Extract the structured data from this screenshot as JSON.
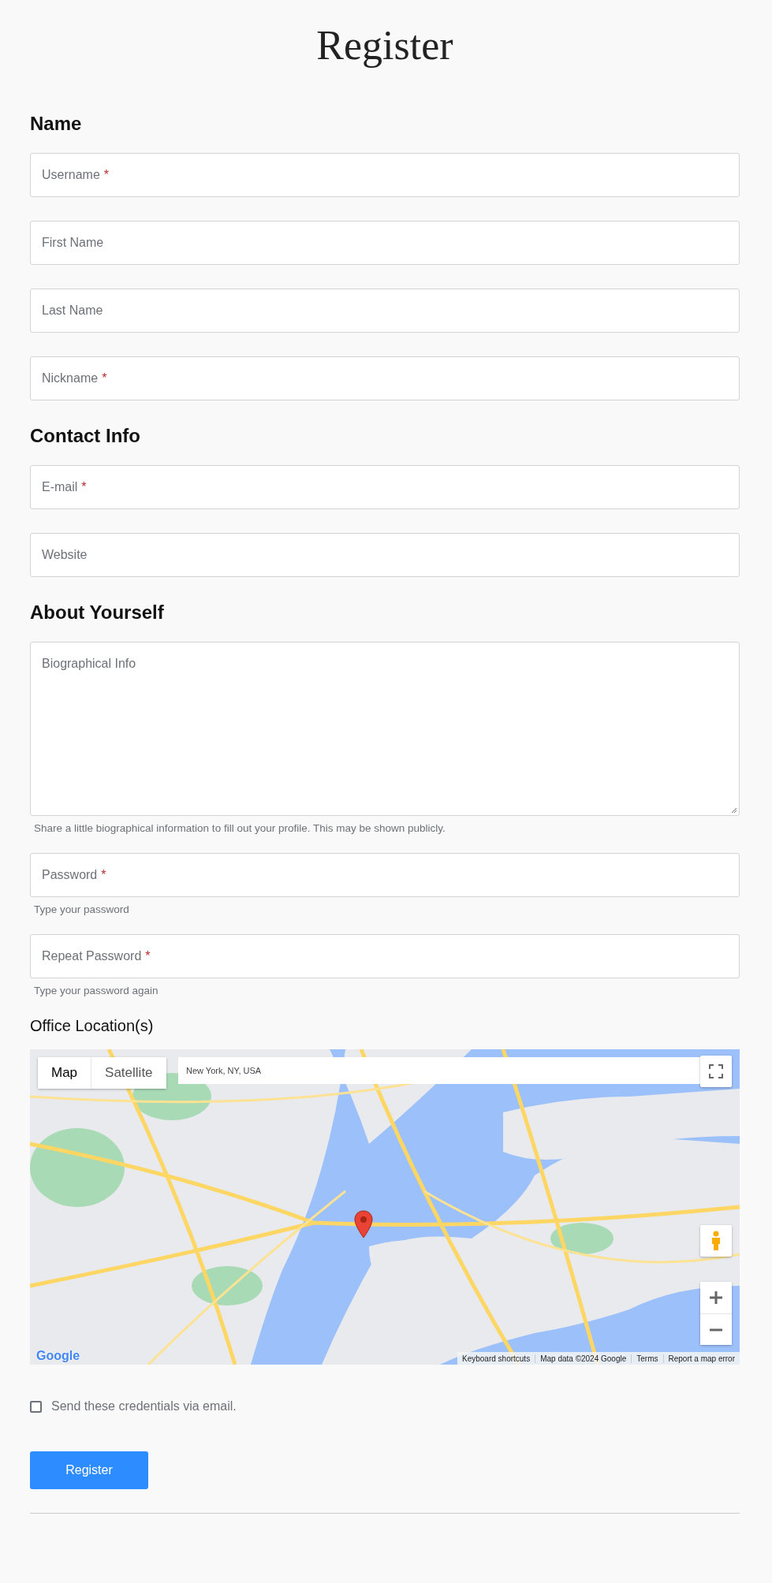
{
  "title": "Register",
  "sections": [
    {
      "heading": "Name",
      "fields": [
        {
          "kind": "input",
          "placeholder": "Username",
          "required_mark": "*"
        },
        {
          "kind": "input",
          "placeholder": "First Name"
        },
        {
          "kind": "input",
          "placeholder": "Last Name"
        },
        {
          "kind": "input",
          "placeholder": "Nickname",
          "required_mark": "*"
        }
      ]
    },
    {
      "heading": "Contact Info",
      "fields": [
        {
          "kind": "input",
          "placeholder": "E-mail",
          "required_mark": "*"
        },
        {
          "kind": "input",
          "placeholder": "Website"
        }
      ]
    },
    {
      "heading": "About Yourself",
      "fields": [
        {
          "kind": "textarea",
          "placeholder": "Biographical Info",
          "hint": "Share a little biographical information to fill out your profile. This may be shown publicly."
        },
        {
          "kind": "input",
          "placeholder": "Password",
          "required_mark": "*",
          "hint": "Type your password"
        },
        {
          "kind": "input",
          "placeholder": "Repeat Password",
          "required_mark": "*",
          "hint": "Type your password again"
        }
      ]
    }
  ],
  "map": {
    "label": "Office Location(s)",
    "tabs": [
      {
        "label": "Map",
        "selected": true
      },
      {
        "label": "Satellite",
        "selected": false
      }
    ],
    "search": {
      "value": "New York, NY, USA"
    },
    "logo": "Google",
    "attribution": [
      "Keyboard shortcuts",
      "Map data ©2024 Google",
      "Terms",
      "Report a map error"
    ]
  },
  "email_credentials": {
    "label": "Send these credentials via email.",
    "checked": false
  },
  "submit": "Register"
}
